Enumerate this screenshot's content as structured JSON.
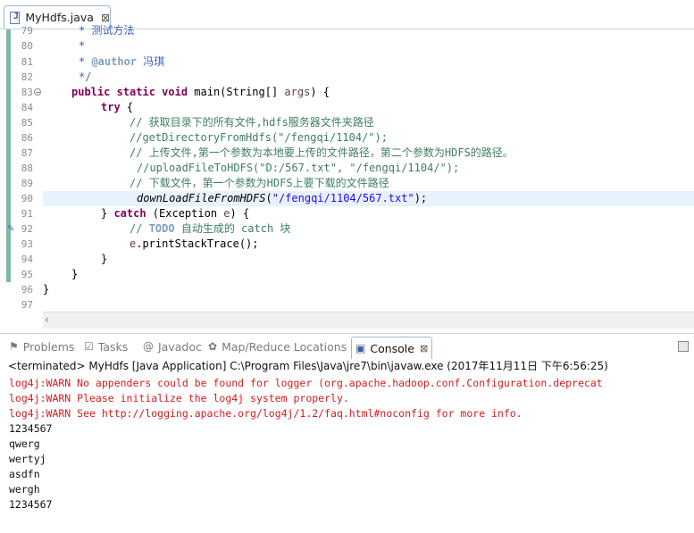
{
  "editor": {
    "tab_label": "MyHdfs.java",
    "tab_close": "⊠",
    "lines": [
      {
        "n": "79"
      },
      {
        "n": "80"
      },
      {
        "n": "81"
      },
      {
        "n": "82"
      },
      {
        "n": "83"
      },
      {
        "n": "84"
      },
      {
        "n": "85"
      },
      {
        "n": "86"
      },
      {
        "n": "87"
      },
      {
        "n": "88"
      },
      {
        "n": "89"
      },
      {
        "n": "90"
      },
      {
        "n": "91"
      },
      {
        "n": "92"
      },
      {
        "n": "93"
      },
      {
        "n": "94"
      },
      {
        "n": "95"
      },
      {
        "n": "96"
      },
      {
        "n": "97"
      }
    ],
    "code": {
      "l79": "* 测试方法",
      "l80": "*",
      "l81_tag": "@author",
      "l81_text": " 冯琪",
      "l82": "*/",
      "l83_kw": "public static void",
      "l83_a": " main(String[] ",
      "l83_var": "args",
      "l83_b": ") {",
      "l84_kw": "try",
      "l84_b": " {",
      "l85": "// 获取目录下的所有文件,hdfs服务器文件夹路径",
      "l86": "//getDirectoryFromHdfs(\"/fengqi/1104/\");",
      "l87": "// 上传文件,第一个参数为本地要上传的文件路径，第二个参数为HDFS的路径。",
      "l88": "//uploadFileToHDFS(\"D:/567.txt\", \"/fengqi/1104/\");",
      "l89": "// 下载文件，第一个参数为HDFS上要下载的文件路径",
      "l90_fn": "downLoadFileFromHDFS",
      "l90_a": "(",
      "l90_str": "\"/fengqi/1104/567.txt\"",
      "l90_b": ");",
      "l91_a": "} ",
      "l91_kw": "catch",
      "l91_b": " (Exception ",
      "l91_var": "e",
      "l91_c": ") {",
      "l92_a": "// ",
      "l92_todo": "TODO",
      "l92_b": " 自动生成的 catch 块",
      "l93_var": "e",
      "l93_b": ".printStackTrace();",
      "l94": "}",
      "l95": "}",
      "l96": "}"
    }
  },
  "views": {
    "problems": "Problems",
    "tasks": "Tasks",
    "javadoc": "Javadoc",
    "mapreduce": "Map/Reduce Locations",
    "console": "Console",
    "console_close": "⊠"
  },
  "console": {
    "header": "<terminated> MyHdfs [Java Application] C:\\Program Files\\Java\\jre7\\bin\\javaw.exe (2017年11月11日 下午6:56:25)",
    "lines": [
      {
        "text": "log4j:WARN No appenders could be found for logger (org.apache.hadoop.conf.Configuration.deprecat",
        "kind": "err"
      },
      {
        "text": "log4j:WARN Please initialize the log4j system properly.",
        "kind": "err"
      },
      {
        "text": "log4j:WARN See http://logging.apache.org/log4j/1.2/faq.html#noconfig for more info.",
        "kind": "err"
      },
      {
        "text": "1234567",
        "kind": "out"
      },
      {
        "text": "qwerg",
        "kind": "out"
      },
      {
        "text": "wertyj",
        "kind": "out"
      },
      {
        "text": "asdfn",
        "kind": "out"
      },
      {
        "text": "wergh",
        "kind": "out"
      },
      {
        "text": "1234567",
        "kind": "out"
      }
    ]
  }
}
